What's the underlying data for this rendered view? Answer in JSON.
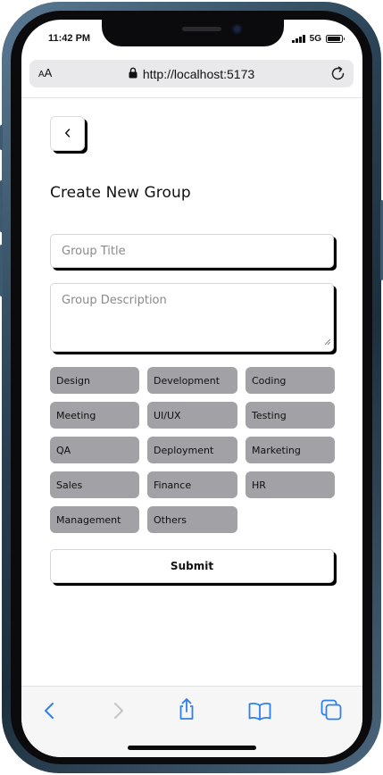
{
  "status_bar": {
    "time": "11:42 PM",
    "network": "5G",
    "battery_level": 0.9
  },
  "browser": {
    "text_size_label_small": "A",
    "text_size_label_large": "A",
    "url": "http://localhost:5173",
    "icons": [
      "lock-icon",
      "reload-icon",
      "back-icon",
      "forward-icon",
      "share-icon",
      "bookmarks-icon",
      "tabs-icon"
    ]
  },
  "page": {
    "title": "Create New Group",
    "title_placeholder": "Group Title",
    "description_placeholder": "Group Description",
    "tags": [
      "Design",
      "Development",
      "Coding",
      "Meeting",
      "UI/UX",
      "Testing",
      "QA",
      "Deployment",
      "Marketing",
      "Sales",
      "Finance",
      "HR",
      "Management",
      "Others"
    ],
    "submit_label": "Submit"
  },
  "colors": {
    "accent": "#2f80ed",
    "tag_bg": "#a1a1a6",
    "shadow": "#000000"
  }
}
